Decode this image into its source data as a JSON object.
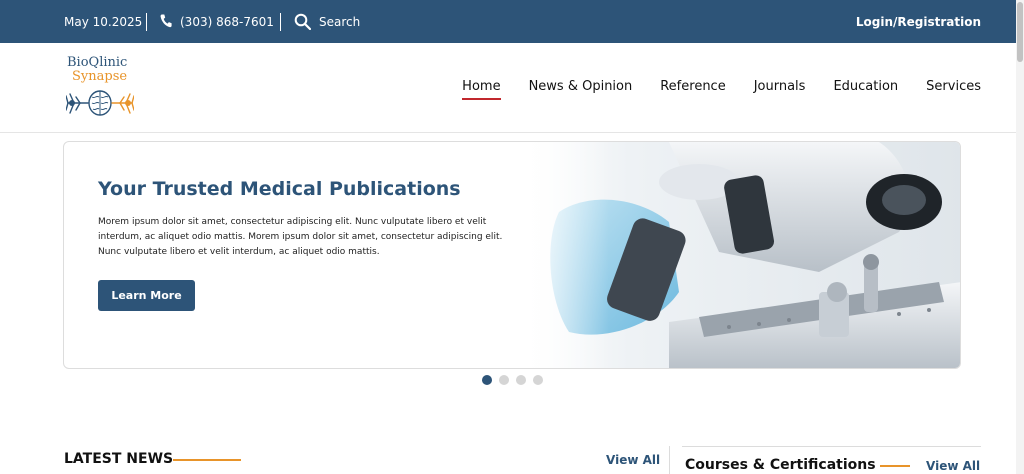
{
  "topbar": {
    "date": "May 10.2025",
    "phone": "(303) 868-7601",
    "search_label": "Search",
    "login_label": "Login/Registration"
  },
  "logo": {
    "line1": "BioQlinic",
    "line2": "Synapse"
  },
  "nav": {
    "items": [
      {
        "label": "Home",
        "active": true
      },
      {
        "label": "News & Opinion"
      },
      {
        "label": "Reference"
      },
      {
        "label": "Journals"
      },
      {
        "label": "Education"
      },
      {
        "label": "Services"
      }
    ]
  },
  "hero": {
    "title": "Your Trusted Medical Publications",
    "body": "Morem ipsum dolor sit amet, consectetur adipiscing elit. Nunc vulputate libero et velit interdum, ac aliquet odio mattis. Morem ipsum dolor sit amet, consectetur adipiscing elit. Nunc vulputate libero et velit interdum, ac aliquet odio mattis.",
    "button_label": "Learn More",
    "image": "microscope-photo"
  },
  "carousel": {
    "count": 4,
    "active_index": 0
  },
  "latest_news": {
    "heading": "LATEST NEWS",
    "view_all": "View All"
  },
  "courses": {
    "heading": "Courses & Certifications",
    "view_all": "View All"
  },
  "colors": {
    "brand": "#2d5478",
    "accent": "#e8942a",
    "active_underline": "#c1272d"
  },
  "icons": {
    "phone": "phone-icon",
    "search": "search-icon",
    "logo": "brain-neuron-logo"
  }
}
